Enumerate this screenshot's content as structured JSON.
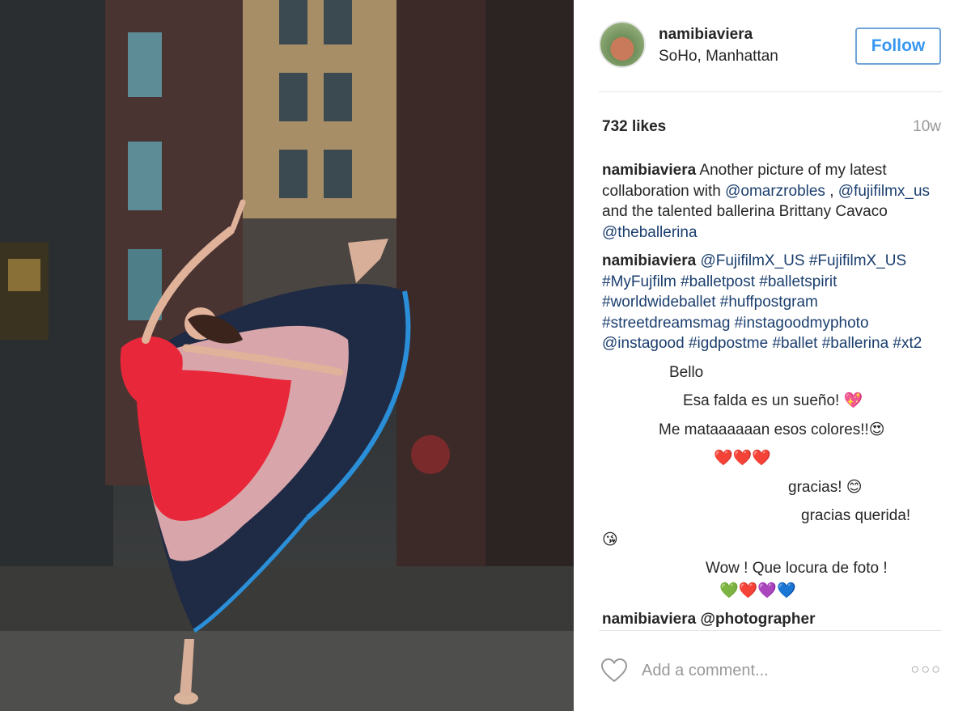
{
  "post": {
    "username": "namibiaviera",
    "location": "SoHo, Manhattan",
    "follow_label": "Follow",
    "likes": "732 likes",
    "time_ago": "10w"
  },
  "caption": {
    "user": "namibiaviera",
    "text_parts": [
      "Another picture of my latest collaboration with ",
      "@omarzrobles",
      " , ",
      "@fujifilmx_us",
      " and the talented ballerina Brittany Cavaco ",
      "@theballerina"
    ]
  },
  "hashtags_comment": {
    "user": "namibiaviera",
    "tags": "@FujifilmX_US #FujifilmX_US #MyFujfilm #balletpost #balletspirit #worldwideballet #huffpostgram #streetdreamsmag #instagoodmyphoto @instagood #igdpostme #ballet #ballerina #xt2"
  },
  "comments": [
    "Bello",
    "Esa falda es un sueño! 💖",
    "Me mataaaaaan esos colores!!😍",
    "❤️❤️❤️",
    "gracias! 😊",
    "gracias querida!",
    "😘",
    "Wow ! Que locura de foto !",
    "💚❤️💜💙"
  ],
  "partial_comment": "namibiaviera @photographer",
  "add_comment": {
    "placeholder": "Add a comment..."
  },
  "icons": {
    "heart": "heart-outline-icon",
    "more": "more-options-icon"
  },
  "colors": {
    "follow_blue": "#3897f0",
    "tag_blue": "#1a3e6e",
    "muted": "#999999"
  }
}
